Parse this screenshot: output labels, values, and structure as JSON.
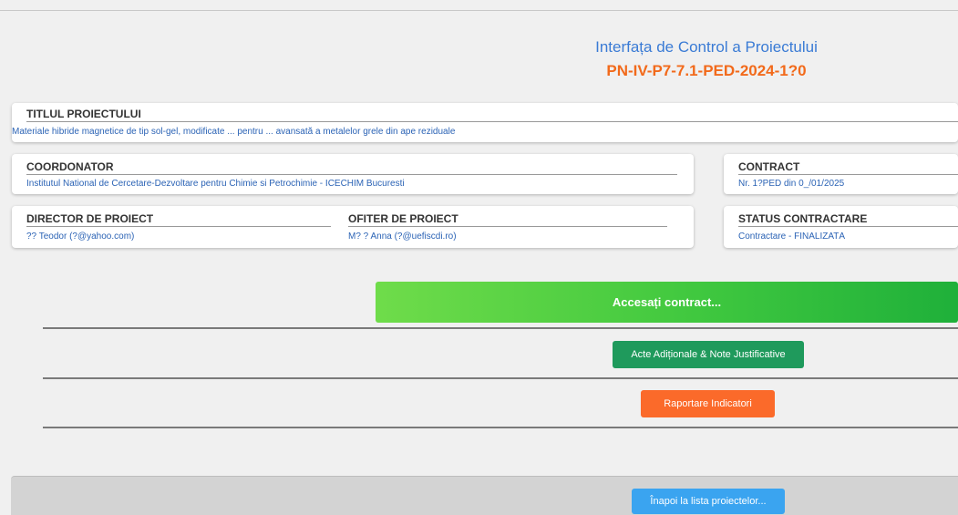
{
  "header": {
    "title": "Interfața de Control a Proiectului",
    "code": "PN-IV-P7-7.1-PED-2024-1?0"
  },
  "titlu": {
    "label": "TITLUL PROIECTULUI",
    "value": "Materiale hibride magnetice de tip sol-gel, modificate ... pentru ... avansată a metalelor grele din ape reziduale"
  },
  "coordonator": {
    "label": "COORDONATOR",
    "value": "Institutul National de Cercetare-Dezvoltare pentru Chimie si Petrochimie - ICECHIM Bucuresti"
  },
  "contract": {
    "label": "CONTRACT",
    "value": "Nr. 1?PED din 0_/01/2025"
  },
  "director": {
    "label": "DIRECTOR DE PROIECT",
    "value": "?? Teodor (?@yahoo.com)"
  },
  "ofiter": {
    "label": "OFITER DE PROIECT",
    "value": "M? ? Anna (?@uefiscdi.ro)"
  },
  "status": {
    "label": "STATUS CONTRACTARE",
    "value": "Contractare - FINALIZATĂ"
  },
  "actions": {
    "access_contract": "Accesați contract...",
    "acte_aditionale": "Acte Adiționale & Note Justificative",
    "raportare": "Raportare Indicatori",
    "back": "Înapoi la lista proiectelor..."
  },
  "colors": {
    "title_blue": "#3a7bd5",
    "code_orange": "#f26a1b",
    "access_green": "#40c83f",
    "acte_green": "#1f9a5c",
    "raportare_orange": "#fb6a2a",
    "back_blue": "#3aa4f0"
  }
}
